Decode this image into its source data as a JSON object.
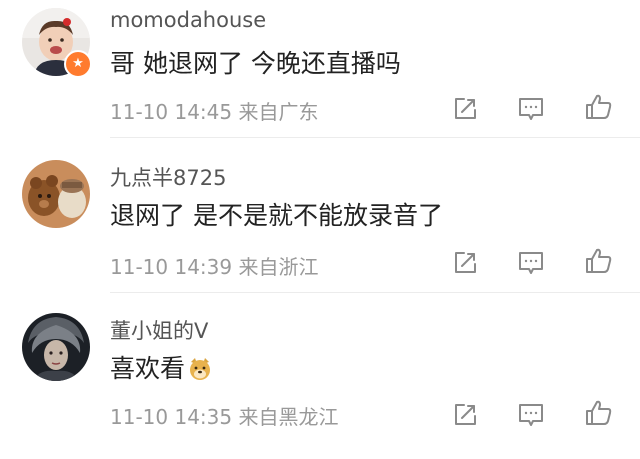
{
  "comments": [
    {
      "username": "momodahouse",
      "content": "哥 她退网了 今晚还直播吗",
      "time": "11-10 14:45",
      "location": "来自广东",
      "avatar_icon": "toddler-photo-avatar",
      "badge_icon": "star-badge-icon",
      "has_emoji": false
    },
    {
      "username": "九点半8725",
      "content": "退网了 是不是就不能放录音了",
      "time": "11-10 14:39",
      "location": "来自浙江",
      "avatar_icon": "teddy-bear-photo-avatar",
      "has_emoji": false
    },
    {
      "username": "董小姐的V",
      "content": "喜欢看",
      "time": "11-10 14:35",
      "location": "来自黑龙江",
      "avatar_icon": "lion-woman-art-avatar",
      "emoji": "doge-emoji-icon",
      "has_emoji": true
    }
  ],
  "actions": [
    "repost-icon",
    "comment-icon",
    "like-icon"
  ],
  "colors": {
    "username": "#555555",
    "content": "#222222",
    "meta": "#999999",
    "icon": "#8a8a8a",
    "badge": "#ff7b2e",
    "divider": "#ececec"
  }
}
